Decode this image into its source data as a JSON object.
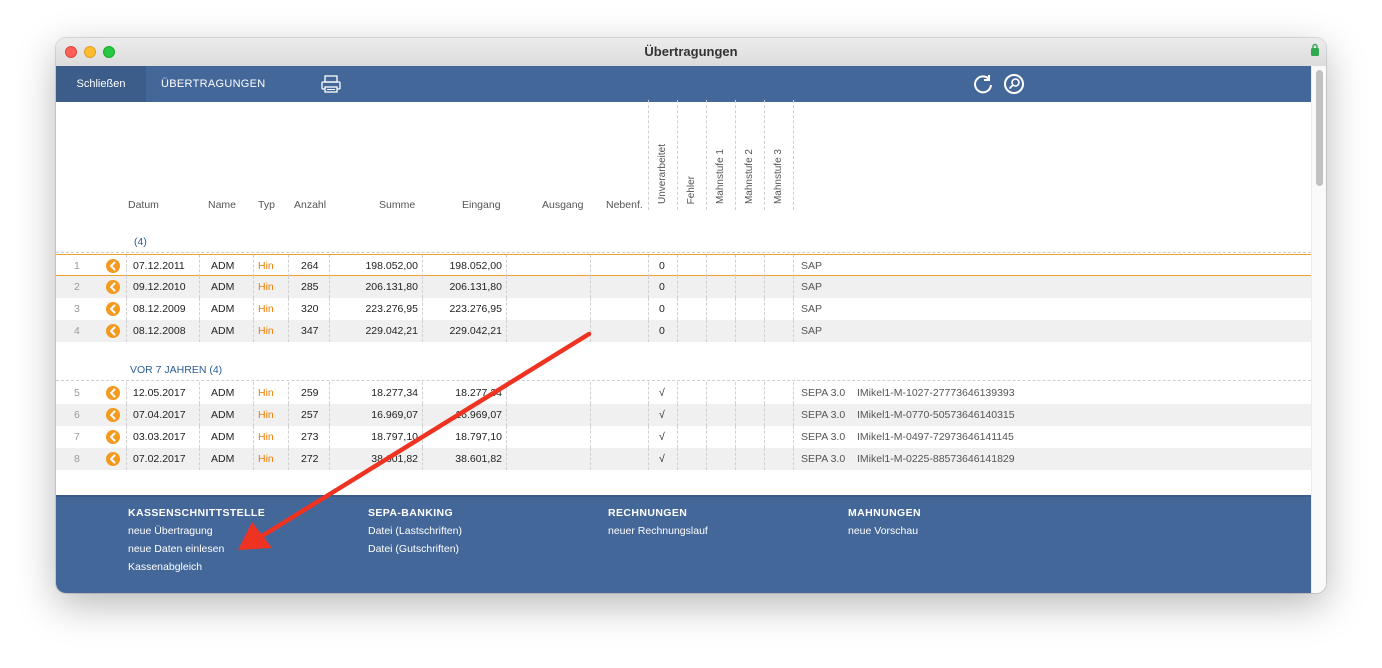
{
  "window": {
    "title": "Übertragungen"
  },
  "toolbar": {
    "close_label": "Schließen",
    "tab_label": "ÜBERTRAGUNGEN",
    "print_icon": "printer-icon",
    "refresh_icon": "refresh-icon",
    "search_icon": "search-icon"
  },
  "columns": {
    "datum": "Datum",
    "name": "Name",
    "typ": "Typ",
    "anzahl": "Anzahl",
    "summe": "Summe",
    "eingang": "Eingang",
    "ausgang": "Ausgang",
    "nebenf": "Nebenf.",
    "unverarbeitet": "Unverarbeitet",
    "fehler": "Fehler",
    "mahnstufe1": "Mahnstufe 1",
    "mahnstufe2": "Mahnstufe 2",
    "mahnstufe3": "Mahnstufe 3"
  },
  "groups": [
    {
      "label": "(4)",
      "rows": [
        {
          "num": "1",
          "datum": "07.12.2011",
          "name": "ADM",
          "typ": "Hin",
          "anzahl": "264",
          "summe": "198.052,00",
          "eingang": "198.052,00",
          "unverarbeitet": "0",
          "info": "SAP"
        },
        {
          "num": "2",
          "datum": "09.12.2010",
          "name": "ADM",
          "typ": "Hin",
          "anzahl": "285",
          "summe": "206.131,80",
          "eingang": "206.131,80",
          "unverarbeitet": "0",
          "info": "SAP"
        },
        {
          "num": "3",
          "datum": "08.12.2009",
          "name": "ADM",
          "typ": "Hin",
          "anzahl": "320",
          "summe": "223.276,95",
          "eingang": "223.276,95",
          "unverarbeitet": "0",
          "info": "SAP"
        },
        {
          "num": "4",
          "datum": "08.12.2008",
          "name": "ADM",
          "typ": "Hin",
          "anzahl": "347",
          "summe": "229.042,21",
          "eingang": "229.042,21",
          "unverarbeitet": "0",
          "info": "SAP"
        }
      ]
    },
    {
      "label": "VOR 7 JAHREN (4)",
      "rows": [
        {
          "num": "5",
          "datum": "12.05.2017",
          "name": "ADM",
          "typ": "Hin",
          "anzahl": "259",
          "summe": "18.277,34",
          "eingang": "18.277,34",
          "unverarbeitet": "√",
          "info": "SEPA 3.0",
          "ref": "IMikel1-M-1027-27773646139393"
        },
        {
          "num": "6",
          "datum": "07.04.2017",
          "name": "ADM",
          "typ": "Hin",
          "anzahl": "257",
          "summe": "16.969,07",
          "eingang": "16.969,07",
          "unverarbeitet": "√",
          "info": "SEPA 3.0",
          "ref": "IMikel1-M-0770-50573646140315"
        },
        {
          "num": "7",
          "datum": "03.03.2017",
          "name": "ADM",
          "typ": "Hin",
          "anzahl": "273",
          "summe": "18.797,10",
          "eingang": "18.797,10",
          "unverarbeitet": "√",
          "info": "SEPA 3.0",
          "ref": "IMikel1-M-0497-72973646141145"
        },
        {
          "num": "8",
          "datum": "07.02.2017",
          "name": "ADM",
          "typ": "Hin",
          "anzahl": "272",
          "summe": "38.601,82",
          "eingang": "38.601,82",
          "unverarbeitet": "√",
          "info": "SEPA 3.0",
          "ref": "IMikel1-M-0225-88573646141829"
        }
      ]
    }
  ],
  "footer": {
    "kasse": {
      "title": "KASSENSCHNITTSTELLE",
      "links": [
        "neue Übertragung",
        "neue Daten einlesen",
        "Kassenabgleich"
      ]
    },
    "sepa": {
      "title": "SEPA-BANKING",
      "links": [
        "Datei (Lastschriften)",
        "Datei (Gutschriften)"
      ]
    },
    "rechnungen": {
      "title": "RECHNUNGEN",
      "links": [
        "neuer Rechnungslauf"
      ]
    },
    "mahnungen": {
      "title": "MAHNUNGEN",
      "links": [
        "neue Vorschau"
      ]
    }
  },
  "colors": {
    "accent": "#44679a",
    "orange": "#ef7d00",
    "annotation": "#ee3322",
    "selection": "#f0a030"
  }
}
